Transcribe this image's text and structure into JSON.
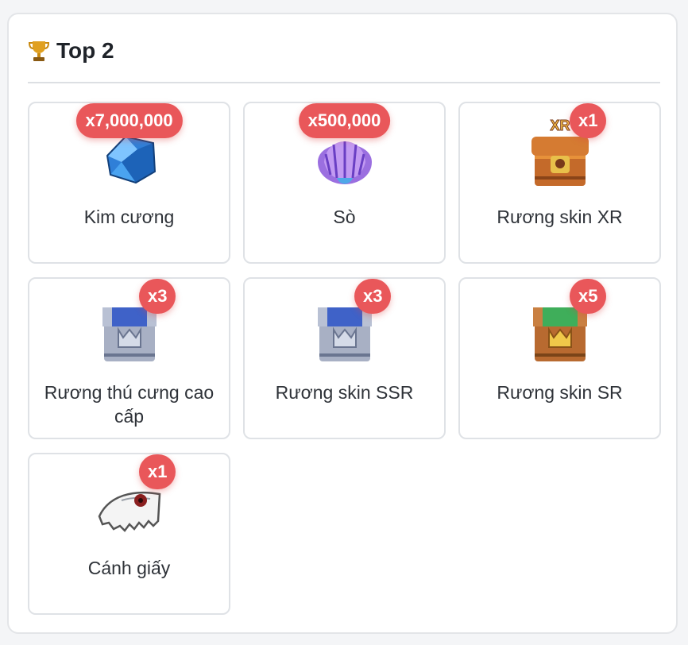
{
  "header": {
    "title": "Top 2",
    "icon": "trophy-icon"
  },
  "items": [
    {
      "label": "Kim cương",
      "qty": "x7,000,000",
      "icon": "diamond-icon"
    },
    {
      "label": "Sò",
      "qty": "x500,000",
      "icon": "shell-icon"
    },
    {
      "label": "Rương skin XR",
      "qty": "x1",
      "icon": "xr-chest-icon",
      "icon_text": "XR"
    },
    {
      "label": "Rương thú cưng cao cấp",
      "qty": "x3",
      "icon": "silver-chest-icon"
    },
    {
      "label": "Rương skin SSR",
      "qty": "x3",
      "icon": "silver-chest-icon"
    },
    {
      "label": "Rương skin SR",
      "qty": "x5",
      "icon": "bronze-chest-icon"
    },
    {
      "label": "Cánh giấy",
      "qty": "x1",
      "icon": "paper-wing-icon"
    }
  ],
  "colors": {
    "badge": "#e9575a",
    "border": "#dfe2e6",
    "title": "#1f2329"
  }
}
